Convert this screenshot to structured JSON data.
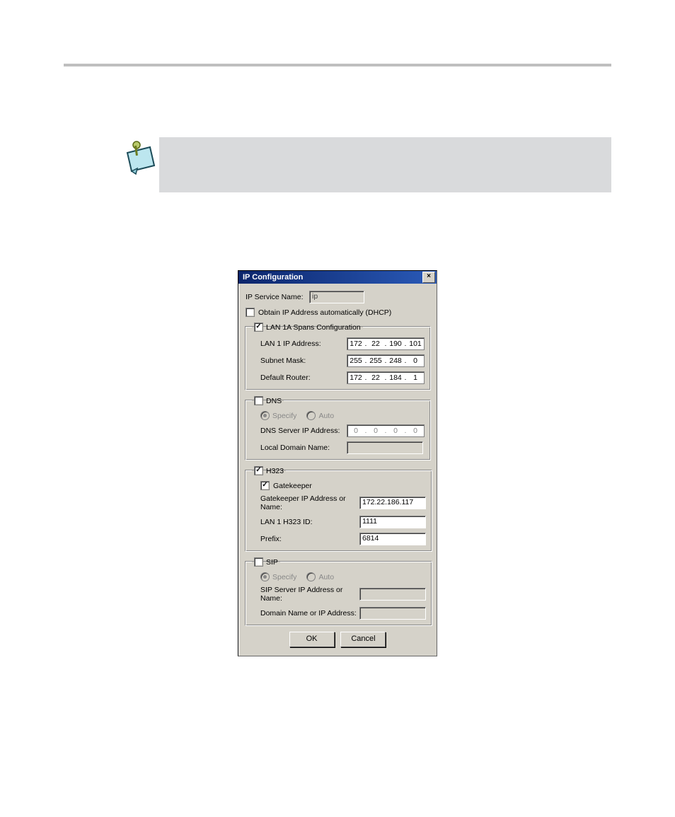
{
  "dialog": {
    "title": "IP Configuration",
    "ip_service_name_label": "IP Service Name:",
    "ip_service_name_value": "ip",
    "dhcp_label": "Obtain IP Address automatically (DHCP)",
    "dhcp_checked": false,
    "lan": {
      "legend": "LAN 1A Spans Configuration",
      "checked": true,
      "ip_label": "LAN 1 IP Address:",
      "ip": [
        "172",
        "22",
        "190",
        "101"
      ],
      "subnet_label": "Subnet Mask:",
      "subnet": [
        "255",
        "255",
        "248",
        "0"
      ],
      "router_label": "Default Router:",
      "router": [
        "172",
        "22",
        "184",
        "1"
      ]
    },
    "dns": {
      "legend": "DNS",
      "checked": false,
      "specify_label": "Specify",
      "auto_label": "Auto",
      "server_label": "DNS Server IP Address:",
      "server_ip": [
        "0",
        "0",
        "0",
        "0"
      ],
      "local_domain_label": "Local Domain Name:",
      "local_domain_value": ""
    },
    "h323": {
      "legend": "H323",
      "checked": true,
      "gatekeeper_label": "Gatekeeper",
      "gatekeeper_checked": true,
      "gk_ip_label": "Gatekeeper IP Address or Name:",
      "gk_ip_value": "172.22.186.117",
      "h323id_label": "LAN 1 H323 ID:",
      "h323id_value": "1111",
      "prefix_label": "Prefix:",
      "prefix_value": "6814"
    },
    "sip": {
      "legend": "SIP",
      "checked": false,
      "specify_label": "Specify",
      "auto_label": "Auto",
      "server_label": "SIP Server IP Address or Name:",
      "server_value": "",
      "domain_label": "Domain Name or IP Address:",
      "domain_value": ""
    },
    "ok_label": "OK",
    "cancel_label": "Cancel"
  }
}
